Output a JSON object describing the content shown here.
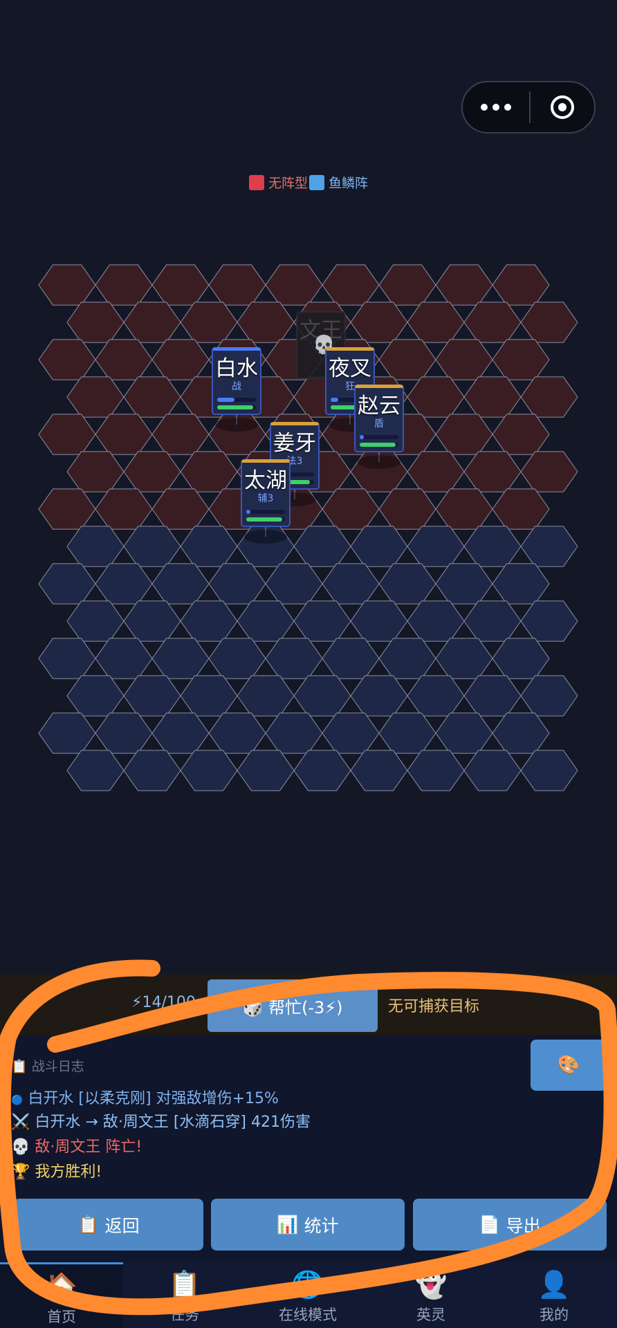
{
  "capsule": {
    "more_icon": "more-dots-icon",
    "close_icon": "target-circle-icon"
  },
  "legend": [
    {
      "label": "无阵型",
      "color": "#e03c4f"
    },
    {
      "label": "鱼鳞阵",
      "color": "#4fa3e8"
    }
  ],
  "board": {
    "rows": 14,
    "cols": 9,
    "enemy_rows": 7,
    "enemy_color": "#3a1d22",
    "ally_color": "#1e2745",
    "hex_stroke": "#8a8fa3"
  },
  "units": [
    {
      "name": "文王",
      "class": "",
      "dead": true,
      "skull_icon": "skull-icon"
    },
    {
      "name": "白水",
      "class": "战",
      "top": "blue",
      "mp": 0.45,
      "hp": 0.92
    },
    {
      "name": "夜叉",
      "class": "狂",
      "top": "gold",
      "mp": 0.2,
      "hp": 0.9
    },
    {
      "name": "赵云",
      "class": "盾",
      "top": "gold",
      "mp": 0.1,
      "hp": 0.92
    },
    {
      "name": "姜牙",
      "class": "法3",
      "top": "gold",
      "mp": 0.15,
      "hp": 0.9
    },
    {
      "name": "太湖",
      "class": "辅3",
      "top": "gold",
      "mp": 0.1,
      "hp": 0.92
    }
  ],
  "actionbar": {
    "energy": "⚡14/100",
    "help_button": "🎲 帮忙(-3⚡)",
    "capture_status": "无可捕获目标"
  },
  "log": {
    "title": "📋 战斗日志",
    "palette_icon": "🎨",
    "lines": [
      {
        "icon": "🔵",
        "text": "白开水 [以柔克刚] 对强敌增伤+15%",
        "color": "#7fb3f0"
      },
      {
        "icon": "⚔️",
        "text": "白开水 → 敌·周文王 [水滴石穿] 421伤害",
        "color": "#8fc0f5"
      },
      {
        "icon": "💀",
        "text": "敌·周文王 阵亡!",
        "color": "#f06868"
      },
      {
        "icon": "🏆",
        "text": "我方胜利!",
        "color": "#f1d36b"
      }
    ]
  },
  "buttons": {
    "back": {
      "icon": "📋",
      "label": "返回"
    },
    "stats": {
      "icon": "📊",
      "label": "统计"
    },
    "export": {
      "icon": "📄",
      "label": "导出"
    }
  },
  "tabs": [
    {
      "icon": "🏠",
      "label": "首页"
    },
    {
      "icon": "📋",
      "label": "任务"
    },
    {
      "icon": "🌐",
      "label": "在线模式"
    },
    {
      "icon": "👻",
      "label": "英灵"
    },
    {
      "icon": "👤",
      "label": "我的"
    }
  ]
}
